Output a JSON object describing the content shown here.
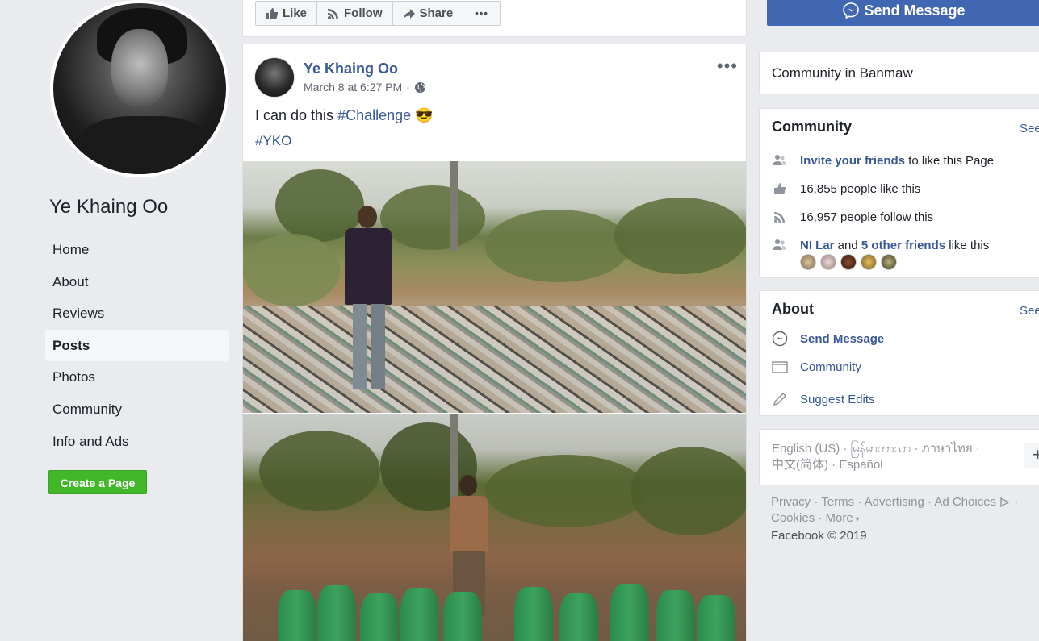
{
  "page": {
    "name": "Ye Khaing Oo"
  },
  "nav": {
    "items": [
      {
        "label": "Home"
      },
      {
        "label": "About"
      },
      {
        "label": "Reviews"
      },
      {
        "label": "Posts"
      },
      {
        "label": "Photos"
      },
      {
        "label": "Community"
      },
      {
        "label": "Info and Ads"
      }
    ],
    "active": "Posts",
    "create_page": "Create a Page"
  },
  "actions": {
    "like": "Like",
    "follow": "Follow",
    "share": "Share",
    "more": "•••",
    "send_message": "Send Message"
  },
  "post": {
    "author": "Ye Khaing Oo",
    "date": "March 8 at 6:27 PM",
    "audience_icon": "globe-icon",
    "text_prefix": "I can do this ",
    "hashtag": "#Challenge",
    "emoji": "😎",
    "hashtag2": "#YKO",
    "more": "•••"
  },
  "community_in": {
    "title": "Community in Banmaw"
  },
  "community": {
    "title": "Community",
    "see_all": "See",
    "invite_link": "Invite your friends",
    "invite_rest": " to like this Page",
    "likes": "16,855 people like this",
    "follows": "16,957 people follow this",
    "friend_name": "NI Lar",
    "and": " and ",
    "others_link": "5 other friends",
    "others_rest": " like this"
  },
  "about": {
    "title": "About",
    "see_all": "See",
    "send_message": "Send Message",
    "category": "Community",
    "suggest": "Suggest Edits"
  },
  "languages": {
    "items": [
      "English (US)",
      "မြန်မာဘာသာ",
      "ภาษาไทย",
      "中文(简体)",
      "Español"
    ],
    "add": "+"
  },
  "footer": {
    "links": [
      "Privacy",
      "Terms",
      "Advertising",
      "Ad Choices",
      "Cookies",
      "More"
    ],
    "copyright": "Facebook © 2019"
  },
  "colors": {
    "link": "#385898",
    "brand_blue": "#4267b2",
    "create_green": "#42b72a"
  }
}
